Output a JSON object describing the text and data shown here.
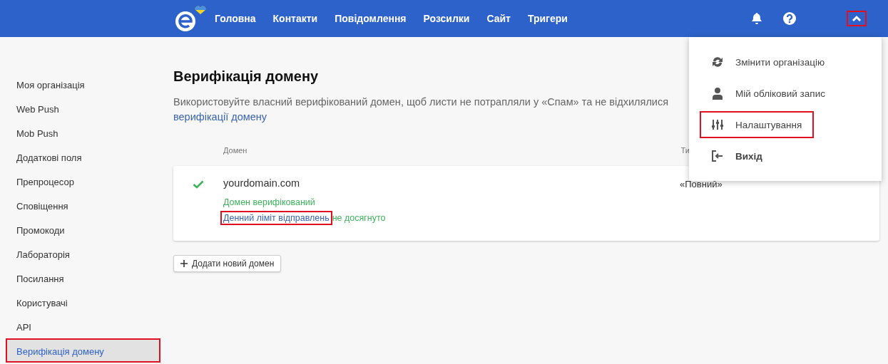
{
  "header": {
    "nav": [
      {
        "label": "Головна"
      },
      {
        "label": "Контакти"
      },
      {
        "label": "Повідомлення"
      },
      {
        "label": "Розсилки"
      },
      {
        "label": "Сайт"
      },
      {
        "label": "Тригери"
      }
    ],
    "menu_toggle": {
      "expanded": true,
      "highlighted": true
    }
  },
  "sidebar": {
    "items": [
      {
        "label": "Моя організація",
        "selected": false,
        "highlighted": false
      },
      {
        "label": "Web Push",
        "selected": false,
        "highlighted": false
      },
      {
        "label": "Mob Push",
        "selected": false,
        "highlighted": false
      },
      {
        "label": "Додаткові поля",
        "selected": false,
        "highlighted": false
      },
      {
        "label": "Препроцесор",
        "selected": false,
        "highlighted": false
      },
      {
        "label": "Сповіщення",
        "selected": false,
        "highlighted": false
      },
      {
        "label": "Промокоди",
        "selected": false,
        "highlighted": false
      },
      {
        "label": "Лабораторія",
        "selected": false,
        "highlighted": false
      },
      {
        "label": "Посилання",
        "selected": false,
        "highlighted": false
      },
      {
        "label": "Користувачі",
        "selected": false,
        "highlighted": false
      },
      {
        "label": "API",
        "selected": false,
        "highlighted": false
      },
      {
        "label": "Верифікація домену",
        "selected": true,
        "highlighted": true
      }
    ]
  },
  "page": {
    "title": "Верифікація домену",
    "description": "Використовуйте власний верифікований домен, щоб листи не потрапляли у «Спам» та не відхилялися",
    "description_link": "верифікації домену",
    "table": {
      "columns": [
        "Домен",
        "Ти"
      ],
      "rows": [
        {
          "verified": true,
          "domain": "yourdomain.com",
          "status": "Домен верифікований",
          "limit_link": "Денний ліміт відправлень",
          "limit_link_highlighted": true,
          "limit_status": "не досягнуто",
          "type": "«Повний»"
        }
      ]
    },
    "add_button": "Додати новий домен"
  },
  "menu": {
    "items": [
      {
        "kind": "sync",
        "label": "Змінити організацію",
        "highlighted": false
      },
      {
        "kind": "user",
        "label": "Мій обліковий запис",
        "highlighted": false
      },
      {
        "kind": "sliders",
        "label": "Налаштування",
        "highlighted": true
      },
      {
        "kind": "exit",
        "label": "Вихід",
        "highlighted": false
      }
    ]
  }
}
